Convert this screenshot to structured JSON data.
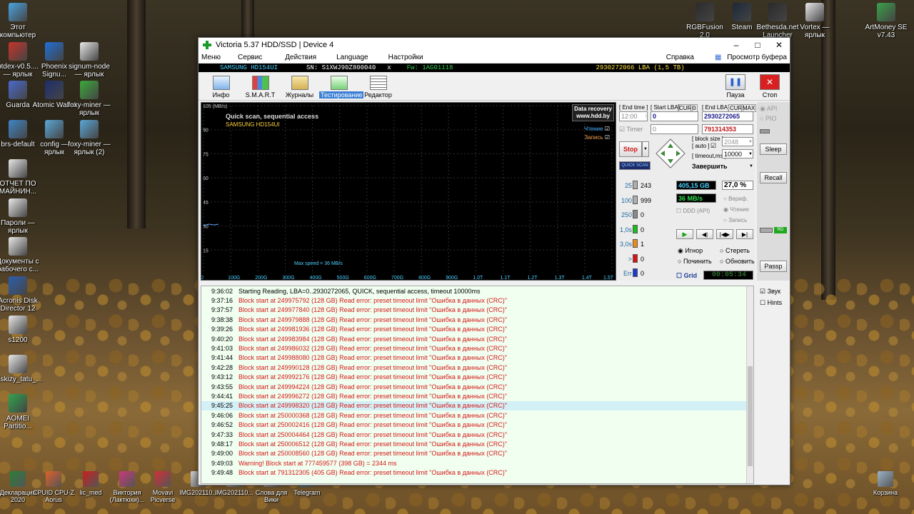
{
  "desktop": {
    "left_icons": [
      {
        "label": "Этот компьютер",
        "color": "#4aa3e0"
      },
      {
        "label": "btdex-v0.5.... — ярлык",
        "color": "#c8342a"
      },
      {
        "label": "Guarda",
        "color": "#4a6ad0"
      },
      {
        "label": "brs-default",
        "color": "#3f86c8"
      },
      {
        "label": "ОТЧЕТ ПО МАЙНИН...",
        "color": "#e8e8e8"
      },
      {
        "label": "Пароли — ярлык",
        "color": "#e8e8e8"
      },
      {
        "label": "Документы с рабочего с...",
        "color": "#e8e8e8"
      },
      {
        "label": "Acronis Disk Director 12",
        "color": "#2d5fae"
      },
      {
        "label": "s1200",
        "color": "#e8e8e8"
      },
      {
        "label": "Eskizy_tatu_...",
        "color": "#e8e8e8"
      },
      {
        "label": "AOMEI Partitio...",
        "color": "#2fa34f"
      }
    ],
    "col2_icons": [
      {
        "label": "Phoenix Signu...",
        "color": "#1f6fd8"
      },
      {
        "label": "Atomic Wallet",
        "color": "#1c2f6e"
      },
      {
        "label": "config — ярлык",
        "color": "#5aa8d8"
      }
    ],
    "col3_icons": [
      {
        "label": "signum-node — ярлык",
        "color": "#e8e8e8"
      },
      {
        "label": "foxy-miner — ярлык",
        "color": "#3caa3c"
      },
      {
        "label": "foxy-miner — ярлык (2)",
        "color": "#5aa8d8"
      }
    ],
    "top_right_icons": [
      {
        "label": "RGBFusion 2.0",
        "color": "#2b2b2b"
      },
      {
        "label": "Steam",
        "color": "#1b2838"
      },
      {
        "label": "Bethesda.net Launcher",
        "color": "#2a2a2a"
      },
      {
        "label": "Vortex — ярлык",
        "color": "#e8e8e8"
      },
      {
        "label": "ArtMoney SE v7.43",
        "color": "#3aa04a"
      }
    ],
    "bottom_icons": [
      {
        "label": "Декларация 2020",
        "color": "#2a7e3a"
      },
      {
        "label": "CPUID CPU-Z Aorus",
        "color": "#e0602a"
      },
      {
        "label": "lic_med",
        "color": "#c82020"
      },
      {
        "label": "Виктория (Лактюхи)...",
        "color": "#c83a7a"
      },
      {
        "label": "Movavi Picverse",
        "color": "#d0303a"
      },
      {
        "label": "IMG202110...",
        "color": "#d0d0d0"
      },
      {
        "label": "IMG202110...",
        "color": "#d0d0d0"
      },
      {
        "label": "Слова для Вики",
        "color": "#d0d0d0"
      },
      {
        "label": "Telegram",
        "color": "#2ea0d8"
      },
      {
        "label": "Корзина",
        "color": "#9ab4c8"
      }
    ]
  },
  "window": {
    "title": "Victoria 5.37 HDD/SSD | Device 4",
    "menu": [
      "Меню",
      "Сервис",
      "Действия",
      "Language",
      "Настройки"
    ],
    "menu_right": [
      "Справка",
      "Просмотр буфера"
    ],
    "device": {
      "model": "SAMSUNG HD154UI",
      "sn": "SN: S1XWJ90Z800040",
      "x": "x",
      "fw": "Fw: 1AG01118",
      "lba": "2930272066 LBA (1,5 TB)"
    },
    "toolbar": [
      "Инфо",
      "S.M.A.R.T",
      "Журналы",
      "Тестирование",
      "Редактор"
    ],
    "toolbar_right": [
      "Пауза",
      "Стоп"
    ]
  },
  "graph": {
    "title": "Quick scan, sequential access",
    "subtitle": "SAMSUNG HD154UI",
    "badge": [
      "Data recovery",
      "www.hdd.by"
    ],
    "legend": [
      "Чтение",
      "Запись"
    ],
    "y_ticks": [
      "105 (MB/s)",
      "90",
      "75",
      "60",
      "45",
      "30",
      "15"
    ],
    "x_ticks": [
      "0",
      "100G",
      "200G",
      "300G",
      "400G",
      "500G",
      "600G",
      "700G",
      "800G",
      "900G",
      "1.0T",
      "1.1T",
      "1.2T",
      "1.3T",
      "1.4T",
      "1.5T"
    ],
    "max_speed": "Max speed = 36 MB/s"
  },
  "controls": {
    "end_time_lbl": "[ End time ]",
    "start_lba_lbl": "[ Start LBA]",
    "cur_lbl": "CUR",
    "zero_lbl": "0",
    "end_lba_lbl": "[ End LBA]",
    "max_lbl": "MAX",
    "end_time": "12:00",
    "start_lba": "0",
    "end_lba": "2930272065",
    "timer_lbl": "Timer",
    "timer_val": "0",
    "cur_lba": "791314353",
    "block_size_lbl": "[ block size ]",
    "auto_lbl": "[ auto ]",
    "block_size": "2048",
    "timeout_lbl": "[ timeout,ms ]",
    "timeout": "10000",
    "stop": "Stop",
    "quick_scan": "QUICK SCAN",
    "finish": "Завершить",
    "counts": [
      {
        "label": "25",
        "value": "243",
        "color": "#b0b0b0"
      },
      {
        "label": "100",
        "value": "999",
        "color": "#b0b0b0"
      },
      {
        "label": "250",
        "value": "0",
        "color": "#8a8a8a"
      },
      {
        "label": "1,0s",
        "value": "0",
        "color": "#18c018"
      },
      {
        "label": "3,0s",
        "value": "1",
        "color": "#f08a1a"
      },
      {
        "label": ">",
        "value": "0",
        "color": "#e01010"
      },
      {
        "label": "Err",
        "value": "0",
        "color": "#1a3ad0"
      }
    ],
    "size": "405,15 GB",
    "percent": "27,0",
    "percent_unit": "%",
    "speed": "36 MB/s",
    "ddd": "DDD (API)",
    "verify": "Вериф.",
    "read": "Чтение",
    "write": "Запись",
    "ignore": "Игнор",
    "erase": "Стереть",
    "repair": "Починить",
    "refresh": "Обновить",
    "grid": "Grid",
    "clock": "00:05:34"
  },
  "side": {
    "api": "API",
    "pio": "PIO",
    "sleep": "Sleep",
    "recall": "Recall",
    "rd": "RD",
    "passp": "Passp",
    "sound": "Звук",
    "hints": "Hints"
  },
  "log": [
    {
      "t": "9:36:02",
      "m": "Starting Reading, LBA=0..2930272065, QUICK, sequential access, timeout 10000ms",
      "k": "info"
    },
    {
      "t": "9:37:16",
      "m": "Block start at 249975792 (128 GB) Read error: preset timeout limit \"Ошибка в данных (CRC)\"",
      "k": "err"
    },
    {
      "t": "9:37:57",
      "m": "Block start at 249977840 (128 GB) Read error: preset timeout limit \"Ошибка в данных (CRC)\"",
      "k": "err"
    },
    {
      "t": "9:38:38",
      "m": "Block start at 249979888 (128 GB) Read error: preset timeout limit \"Ошибка в данных (CRC)\"",
      "k": "err"
    },
    {
      "t": "9:39:26",
      "m": "Block start at 249981936 (128 GB) Read error: preset timeout limit \"Ошибка в данных (CRC)\"",
      "k": "err"
    },
    {
      "t": "9:40:20",
      "m": "Block start at 249983984 (128 GB) Read error: preset timeout limit \"Ошибка в данных (CRC)\"",
      "k": "err"
    },
    {
      "t": "9:41:03",
      "m": "Block start at 249986032 (128 GB) Read error: preset timeout limit \"Ошибка в данных (CRC)\"",
      "k": "err"
    },
    {
      "t": "9:41:44",
      "m": "Block start at 249988080 (128 GB) Read error: preset timeout limit \"Ошибка в данных (CRC)\"",
      "k": "err"
    },
    {
      "t": "9:42:28",
      "m": "Block start at 249990128 (128 GB) Read error: preset timeout limit \"Ошибка в данных (CRC)\"",
      "k": "err"
    },
    {
      "t": "9:43:12",
      "m": "Block start at 249992176 (128 GB) Read error: preset timeout limit \"Ошибка в данных (CRC)\"",
      "k": "err"
    },
    {
      "t": "9:43:55",
      "m": "Block start at 249994224 (128 GB) Read error: preset timeout limit \"Ошибка в данных (CRC)\"",
      "k": "err"
    },
    {
      "t": "9:44:41",
      "m": "Block start at 249996272 (128 GB) Read error: preset timeout limit \"Ошибка в данных (CRC)\"",
      "k": "err"
    },
    {
      "t": "9:45:25",
      "m": "Block start at 249998320 (128 GB) Read error: preset timeout limit \"Ошибка в данных (CRC)\"",
      "k": "err sel"
    },
    {
      "t": "9:46:06",
      "m": "Block start at 250000368 (128 GB) Read error: preset timeout limit \"Ошибка в данных (CRC)\"",
      "k": "err"
    },
    {
      "t": "9:46:52",
      "m": "Block start at 250002416 (128 GB) Read error: preset timeout limit \"Ошибка в данных (CRC)\"",
      "k": "err"
    },
    {
      "t": "9:47:33",
      "m": "Block start at 250004464 (128 GB) Read error: preset timeout limit \"Ошибка в данных (CRC)\"",
      "k": "err"
    },
    {
      "t": "9:48:17",
      "m": "Block start at 250006512 (128 GB) Read error: preset timeout limit \"Ошибка в данных (CRC)\"",
      "k": "err"
    },
    {
      "t": "9:49:00",
      "m": "Block start at 250008560 (128 GB) Read error: preset timeout limit \"Ошибка в данных (CRC)\"",
      "k": "err"
    },
    {
      "t": "9:49:03",
      "m": "Warning! Block start at 777459577 (398 GB)  = 2344 ms",
      "k": "err"
    },
    {
      "t": "9:49:48",
      "m": "Block start at 791312305 (405 GB) Read error: preset timeout limit \"Ошибка в данных (CRC)\"",
      "k": "err"
    }
  ]
}
